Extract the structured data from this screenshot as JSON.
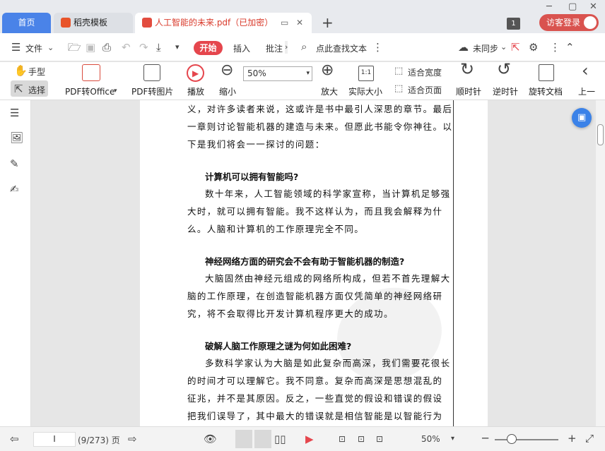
{
  "tabs": {
    "home": "首页",
    "template": "稻壳模板",
    "document": "人工智能的未来.pdf（已加密）",
    "new_tab": "+",
    "badge": "1",
    "login": "访客登录"
  },
  "menu": {
    "file": "文件",
    "start": "开始",
    "insert": "插入",
    "annotate": "批注",
    "search": "点此查找文本",
    "sync": "未同步"
  },
  "toolbar": {
    "hand": "手型",
    "select": "选择",
    "pdf_to_office": "PDF转Office",
    "pdf_to_image": "PDF转图片",
    "play": "播放",
    "zoom_out": "缩小",
    "zoom_value": "50%",
    "zoom_in": "放大",
    "actual_size": "实际大小",
    "fit_width": "适合宽度",
    "fit_page": "适合页面",
    "rotate_cw": "顺时针",
    "rotate_ccw": "逆时针",
    "rotate_doc": "旋转文档",
    "prev": "上一"
  },
  "document": {
    "lines_intro": [
      "义，对许多读者来说，这或许是书中最引人深思的章节。最后",
      "一章则讨论智能机器的建造与未来。但愿此书能令你神往。以",
      "下是我们将会一一探讨的问题："
    ],
    "q1_title": "计算机可以拥有智能吗?",
    "q1_lines": [
      "数十年来，人工智能领域的科学家宣称，当计算机足够强",
      "大时，就可以拥有智能。我不这样认为，而且我会解释为什",
      "么。人脑和计算机的工作原理完全不同。"
    ],
    "q2_title": "神经网络方面的研究会不会有助于智能机器的制造?",
    "q2_lines": [
      "大脑固然由神经元组成的网络所构成，但若不首先理解大",
      "脑的工作原理，在创造智能机器方面仅凭简单的神经网络研",
      "究，将不会取得比开发计算机程序更大的成功。"
    ],
    "q3_title": "破解人脑工作原理之谜为何如此困难?",
    "q3_lines": [
      "多数科学家认为大脑是如此复杂而高深，我们需要花很长",
      "的时间才可以理解它。我不同意。复杂而高深是思想混乱的",
      "征兆，并不是其原因。反之，一些直觉的假设和错误的假设",
      "把我们误导了，其中最大的错误就是相信智能是以智能行为"
    ]
  },
  "status": {
    "page_input": "I",
    "page_info": "(9/273) 页",
    "zoom": "50%"
  }
}
